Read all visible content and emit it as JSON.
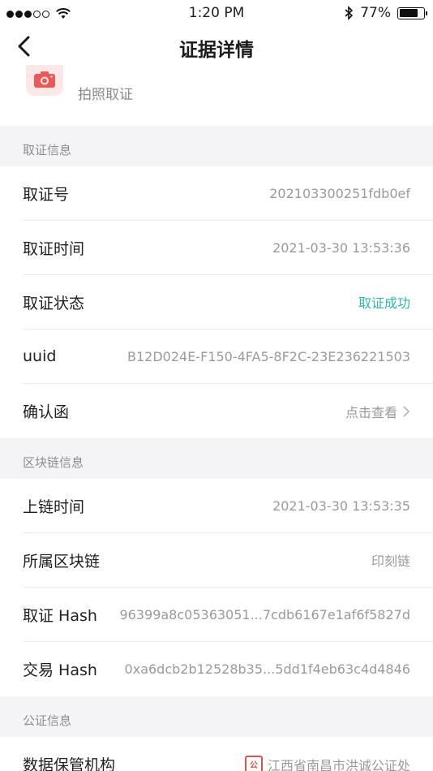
{
  "status_bar": {
    "time": "1:20 PM",
    "battery": "77%",
    "battery_level": 0.77
  },
  "nav": {
    "title": "证据详情"
  },
  "header": {
    "subtitle": "拍照取证"
  },
  "sections": {
    "evidence": {
      "title": "取证信息",
      "rows": [
        {
          "label": "取证号",
          "value": "202103300251fdb0ef"
        },
        {
          "label": "取证时间",
          "value": "2021-03-30  13:53:36"
        },
        {
          "label": "取证状态",
          "value": "取证成功"
        },
        {
          "label": "uuid",
          "value": "B12D024E-F150-4FA5-8F2C-23E236221503"
        },
        {
          "label": "确认函",
          "value": "点击查看"
        }
      ]
    },
    "blockchain": {
      "title": "区块链信息",
      "rows": [
        {
          "label": "上链时间",
          "value": "2021-03-30  13:53:35"
        },
        {
          "label": "所属区块链",
          "value": "印刻链"
        },
        {
          "label": "取证 Hash",
          "value": "96399a8c05363051...7cdb6167e1af6f5827d"
        },
        {
          "label": "交易 Hash",
          "value": "0xa6dcb2b12528b35...5dd1f4eb63c4d4846"
        }
      ]
    },
    "notary": {
      "title": "公证信息",
      "rows": [
        {
          "label": "数据保管机构",
          "value": "江西省南昌市洪诚公证处"
        }
      ]
    }
  },
  "colors": {
    "success": "#2fb8a7",
    "accent": "#e85a5a"
  }
}
